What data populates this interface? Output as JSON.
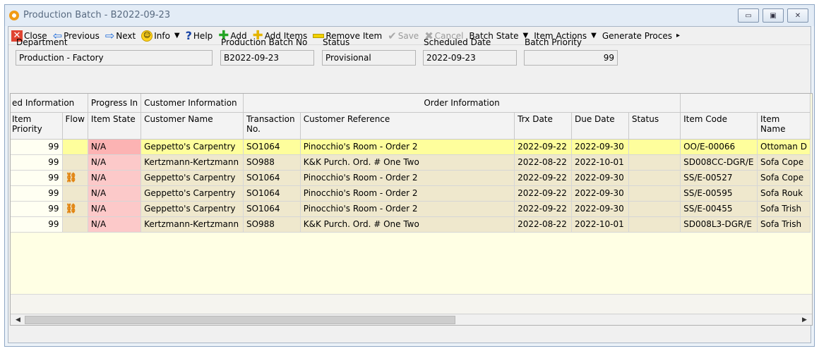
{
  "window": {
    "title": "Production Batch - B2022-09-23",
    "controls": {
      "minimize": "▭",
      "maximize": "▣",
      "close": "✕"
    }
  },
  "toolbar": {
    "close": "Close",
    "previous": "Previous",
    "next": "Next",
    "info": "Info",
    "help": "Help",
    "add": "Add",
    "add_items": "Add Items",
    "remove_item": "Remove Item",
    "save": "Save",
    "cancel": "Cancel",
    "batch_state": "Batch State",
    "item_actions": "Item Actions",
    "generate_proces": "Generate Proces"
  },
  "header": {
    "department": {
      "label": "Department",
      "value": "Production - Factory"
    },
    "batch_no": {
      "label": "Production Batch No",
      "value": "B2022-09-23"
    },
    "status": {
      "label": "Status",
      "value": "Provisional"
    },
    "scheduled_date": {
      "label": "Scheduled Date",
      "value": "2022-09-23"
    },
    "batch_priority": {
      "label": "Batch Priority",
      "value": "99"
    }
  },
  "grid": {
    "bands": [
      "ed Information",
      "Progress In",
      "Customer Information",
      "Order Information",
      ""
    ],
    "columns": [
      "Item Priority",
      "Flow",
      "Item State",
      "Customer Name",
      "Transaction No.",
      "Customer Reference",
      "Trx Date",
      "Due Date",
      "Status",
      "Item Code",
      "Item Name"
    ],
    "rows": [
      {
        "priority": "99",
        "flow": "",
        "state": "N/A",
        "customer": "Geppetto's Carpentry",
        "trx_no": "SO1064",
        "reference": "Pinocchio's Room - Order 2",
        "trx_date": "2022-09-22",
        "due_date": "2022-09-30",
        "status": "",
        "item_code": "OO/E-00066",
        "item_name": "Ottoman D"
      },
      {
        "priority": "99",
        "flow": "",
        "state": "N/A",
        "customer": "Kertzmann-Kertzmann",
        "trx_no": "SO988",
        "reference": "K&K Purch. Ord. # One Two",
        "trx_date": "2022-08-22",
        "due_date": "2022-10-01",
        "status": "",
        "item_code": "SD008CC-DGR/E",
        "item_name": "Sofa Cope"
      },
      {
        "priority": "99",
        "flow": "link",
        "state": "N/A",
        "customer": "Geppetto's Carpentry",
        "trx_no": "SO1064",
        "reference": "Pinocchio's Room - Order 2",
        "trx_date": "2022-09-22",
        "due_date": "2022-09-30",
        "status": "",
        "item_code": "SS/E-00527",
        "item_name": "Sofa Cope"
      },
      {
        "priority": "99",
        "flow": "",
        "state": "N/A",
        "customer": "Geppetto's Carpentry",
        "trx_no": "SO1064",
        "reference": "Pinocchio's Room - Order 2",
        "trx_date": "2022-09-22",
        "due_date": "2022-09-30",
        "status": "",
        "item_code": "SS/E-00595",
        "item_name": "Sofa Rouk"
      },
      {
        "priority": "99",
        "flow": "link",
        "state": "N/A",
        "customer": "Geppetto's Carpentry",
        "trx_no": "SO1064",
        "reference": "Pinocchio's Room - Order 2",
        "trx_date": "2022-09-22",
        "due_date": "2022-09-30",
        "status": "",
        "item_code": "SS/E-00455",
        "item_name": "Sofa Trish"
      },
      {
        "priority": "99",
        "flow": "",
        "state": "N/A",
        "customer": "Kertzmann-Kertzmann",
        "trx_no": "SO988",
        "reference": "K&K Purch. Ord. # One Two",
        "trx_date": "2022-08-22",
        "due_date": "2022-10-01",
        "status": "",
        "item_code": "SD008L3-DGR/E",
        "item_name": "Sofa Trish"
      }
    ]
  },
  "scrollbar": {
    "left": "◀",
    "right": "▶"
  }
}
